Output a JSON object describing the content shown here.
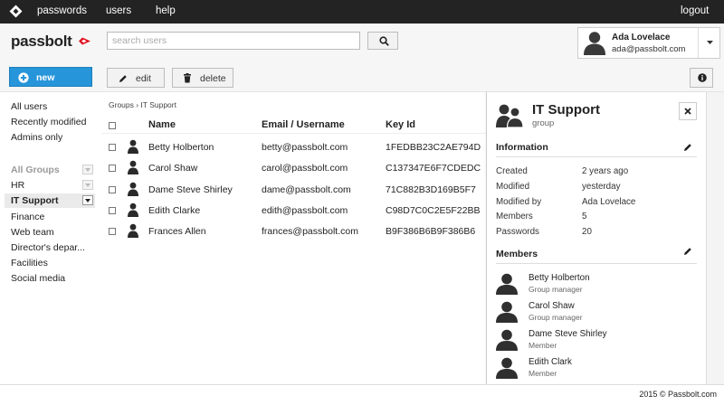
{
  "topbar": {
    "nav": [
      "passwords",
      "users",
      "help"
    ],
    "logout": "logout"
  },
  "header": {
    "brand": "passbolt",
    "search_placeholder": "search users",
    "user": {
      "name": "Ada Lovelace",
      "email": "ada@passbolt.com"
    }
  },
  "actions": {
    "new": "new",
    "edit": "edit",
    "delete": "delete"
  },
  "sidebar": {
    "filters": [
      "All users",
      "Recently modified",
      "Admins only"
    ],
    "groups_title": "All Groups",
    "groups": [
      "HR",
      "IT Support",
      "Finance",
      "Web team",
      "Director's depar...",
      "Facilities",
      "Social media"
    ],
    "selected_group": "IT Support"
  },
  "main": {
    "breadcrumb": "Groups › IT Support",
    "columns": [
      "Name",
      "Email / Username",
      "Key Id"
    ],
    "rows": [
      {
        "name": "Betty Holberton",
        "email": "betty@passbolt.com",
        "key": "1FEDBB23C2AE794D"
      },
      {
        "name": "Carol Shaw",
        "email": "carol@passbolt.com",
        "key": "C137347E6F7CDEDC"
      },
      {
        "name": "Dame Steve Shirley",
        "email": "dame@passbolt.com",
        "key": "71C882B3D169B5F7"
      },
      {
        "name": "Edith Clarke",
        "email": "edith@passbolt.com",
        "key": "C98D7C0C2E5F22BB"
      },
      {
        "name": "Frances Allen",
        "email": "frances@passbolt.com",
        "key": "B9F386B6B9F386B6"
      }
    ]
  },
  "details": {
    "title": "IT Support",
    "subtitle": "group",
    "information_title": "Information",
    "info": [
      {
        "label": "Created",
        "value": "2 years ago"
      },
      {
        "label": "Modified",
        "value": "yesterday"
      },
      {
        "label": "Modified by",
        "value": "Ada Lovelace"
      },
      {
        "label": "Members",
        "value": "5"
      },
      {
        "label": "Passwords",
        "value": "20"
      }
    ],
    "members_title": "Members",
    "members": [
      {
        "name": "Betty Holberton",
        "role": "Group manager"
      },
      {
        "name": "Carol Shaw",
        "role": "Group manager"
      },
      {
        "name": "Dame Steve Shirley",
        "role": "Member"
      },
      {
        "name": "Edith Clark",
        "role": "Member"
      }
    ]
  },
  "footer": {
    "copyright": "2015 © Passbolt.com"
  },
  "colors": {
    "topbar": "#232323",
    "accent_red": "#e0101e",
    "primary_blue": "#2695da"
  },
  "icons": {
    "logo": "passbolt-logo-icon",
    "search": "search-icon",
    "edit": "pencil-icon",
    "delete": "trash-icon",
    "info": "info-icon",
    "user": "user-icon",
    "group": "group-icon",
    "close": "close-icon",
    "caret": "caret-down-icon",
    "new": "plus-circle-icon"
  }
}
